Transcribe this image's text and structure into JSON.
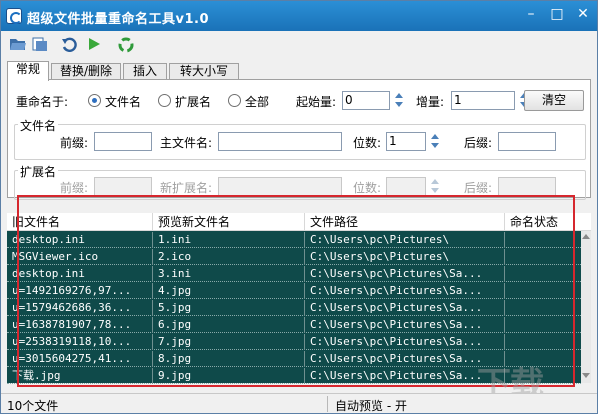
{
  "window": {
    "title": "超级文件批量重命名工具v1.0"
  },
  "titlebar_controls": {
    "minimize": "–",
    "maximize": "□",
    "close": "✕"
  },
  "toolbar": {
    "icons": [
      "open-folder-icon",
      "open-files-icon",
      "undo-icon",
      "run-icon",
      "recycle-icon"
    ]
  },
  "tabs": [
    {
      "label": "常规",
      "active": true
    },
    {
      "label": "替换/删除",
      "active": false
    },
    {
      "label": "插入",
      "active": false
    },
    {
      "label": "转大小写",
      "active": false
    }
  ],
  "rename": {
    "label": "重命名于:",
    "options": [
      {
        "label": "文件名",
        "checked": true
      },
      {
        "label": "扩展名",
        "checked": false
      },
      {
        "label": "全部",
        "checked": false
      }
    ],
    "start_label": "起始量:",
    "start_value": "0",
    "increment_label": "增量:",
    "increment_value": "1",
    "clear_button": "清空"
  },
  "filename_group": {
    "title": "文件名",
    "prefix_label": "前缀:",
    "prefix_value": "",
    "main_label": "主文件名:",
    "main_value": "",
    "digits_label": "位数:",
    "digits_value": "1",
    "suffix_label": "后缀:",
    "suffix_value": ""
  },
  "ext_group": {
    "title": "扩展名",
    "prefix_label": "前缀:",
    "main_label": "新扩展名:",
    "digits_label": "位数:",
    "suffix_label": "后缀:"
  },
  "table": {
    "columns": [
      "旧文件名",
      "预览新文件名",
      "文件路径",
      "命名状态"
    ],
    "rows": [
      [
        "desktop.ini",
        "1.ini",
        "C:\\Users\\pc\\Pictures\\",
        ""
      ],
      [
        "MSGViewer.ico",
        "2.ico",
        "C:\\Users\\pc\\Pictures\\",
        ""
      ],
      [
        "desktop.ini",
        "3.ini",
        "C:\\Users\\pc\\Pictures\\Sa...",
        ""
      ],
      [
        "u=1492169276,97...",
        "4.jpg",
        "C:\\Users\\pc\\Pictures\\Sa...",
        ""
      ],
      [
        "u=1579462686,36...",
        "5.jpg",
        "C:\\Users\\pc\\Pictures\\Sa...",
        ""
      ],
      [
        "u=1638781907,78...",
        "6.jpg",
        "C:\\Users\\pc\\Pictures\\Sa...",
        ""
      ],
      [
        "u=2538319118,10...",
        "7.jpg",
        "C:\\Users\\pc\\Pictures\\Sa...",
        ""
      ],
      [
        "u=3015604275,41...",
        "8.jpg",
        "C:\\Users\\pc\\Pictures\\Sa...",
        ""
      ],
      [
        "下载.jpg",
        "9.jpg",
        "C:\\Users\\pc\\Pictures\\Sa...",
        ""
      ]
    ]
  },
  "status": {
    "file_count": "10个文件",
    "auto_preview": "自动预览 - 开"
  },
  "watermark": "下载",
  "colors": {
    "title_bar": "#1a72b8",
    "table_bg": "#0f4a4a",
    "highlight_frame": "#d6272e"
  }
}
